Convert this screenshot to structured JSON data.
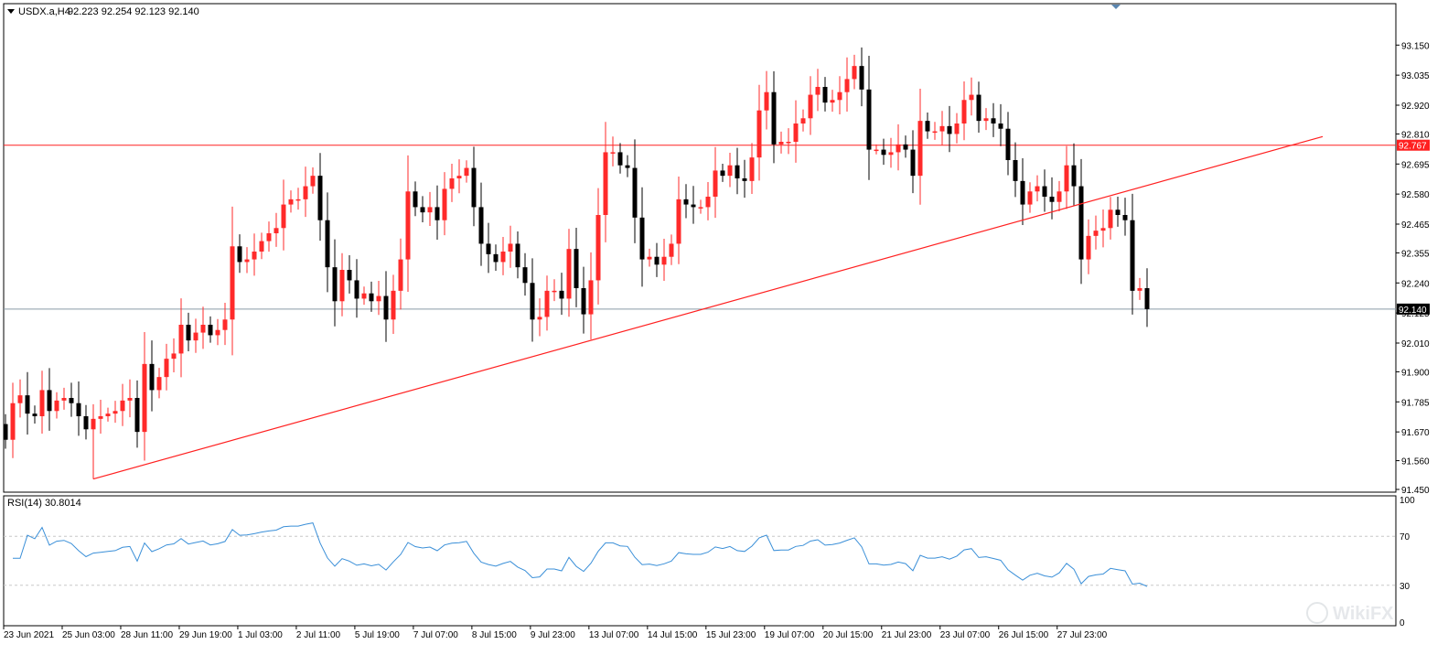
{
  "header": {
    "symbol_timeframe": "USDX.a,H4",
    "ohlc": "92.223 92.254 92.123 92.140"
  },
  "indicator": {
    "label": "RSI(14) 30.8014"
  },
  "watermark": "WikiFX",
  "colors": {
    "bull": "#ff2a2a",
    "bear": "#000000",
    "trendline": "#ff2020",
    "resistance": "#ff2020",
    "current_price": "#8a9aa6",
    "rsi_line": "#3a8fd8",
    "rsi_levels": "#c8c8c8",
    "axis": "#000000"
  },
  "chart_data": [
    {
      "type": "candlestick",
      "title": "USDX.a,H4",
      "ylim": [
        91.45,
        93.2
      ],
      "y_ticks": [
        "93.150",
        "93.035",
        "92.920",
        "92.810",
        "92.695",
        "92.580",
        "92.465",
        "92.355",
        "92.240",
        "92.125",
        "92.010",
        "91.900",
        "91.785",
        "91.670",
        "91.560",
        "91.450"
      ],
      "x_ticks": [
        "23 Jun 2021",
        "25 Jun 03:00",
        "28 Jun 11:00",
        "29 Jun 19:00",
        "1 Jul 03:00",
        "2 Jul 11:00",
        "5 Jul 19:00",
        "7 Jul 07:00",
        "8 Jul 15:00",
        "9 Jul 23:00",
        "13 Jul 07:00",
        "14 Jul 15:00",
        "15 Jul 23:00",
        "19 Jul 07:00",
        "20 Jul 15:00",
        "21 Jul 23:00",
        "23 Jul 07:00",
        "26 Jul 15:00",
        "27 Jul 23:00"
      ],
      "resistance_level": 92.767,
      "resistance_label": "92.767",
      "current_price": 92.14,
      "current_price_label": "92.140",
      "trendline": {
        "from_bar": 12,
        "from_price": 91.49,
        "to_bar": 175,
        "to_price": 92.8
      },
      "closes": [
        91.64,
        91.78,
        91.81,
        91.74,
        91.73,
        91.83,
        91.75,
        91.79,
        91.8,
        91.78,
        91.73,
        91.68,
        91.72,
        91.73,
        91.74,
        91.75,
        91.79,
        91.8,
        91.67,
        91.93,
        91.83,
        91.88,
        91.95,
        91.97,
        92.08,
        92.02,
        92.05,
        92.08,
        92.04,
        92.06,
        92.1,
        92.38,
        92.32,
        92.33,
        92.36,
        92.4,
        92.43,
        92.45,
        92.54,
        92.56,
        92.56,
        92.61,
        92.65,
        92.48,
        92.3,
        92.17,
        92.29,
        92.25,
        92.18,
        92.2,
        92.17,
        92.19,
        92.1,
        92.21,
        92.33,
        92.59,
        92.53,
        92.51,
        92.53,
        92.48,
        92.6,
        92.64,
        92.65,
        92.68,
        92.53,
        92.39,
        92.35,
        92.32,
        92.36,
        92.39,
        92.3,
        92.24,
        92.1,
        92.11,
        92.21,
        92.21,
        92.18,
        92.37,
        92.22,
        92.12,
        92.25,
        92.5,
        92.74,
        92.74,
        92.69,
        92.68,
        92.49,
        92.33,
        92.34,
        92.31,
        92.34,
        92.39,
        92.56,
        92.54,
        92.53,
        92.53,
        92.57,
        92.67,
        92.65,
        92.69,
        92.64,
        92.63,
        92.72,
        92.9,
        92.97,
        92.77,
        92.78,
        92.78,
        92.85,
        92.87,
        92.96,
        92.99,
        92.93,
        92.94,
        92.97,
        93.02,
        93.07,
        92.98,
        92.75,
        92.75,
        92.73,
        92.74,
        92.77,
        92.75,
        92.65,
        92.86,
        92.82,
        92.82,
        92.84,
        92.81,
        92.85,
        92.94,
        92.96,
        92.86,
        92.87,
        92.85,
        92.83,
        92.71,
        92.63,
        92.54,
        92.59,
        92.61,
        92.57,
        92.55,
        92.59,
        92.69,
        92.61,
        92.33,
        92.42,
        92.44,
        92.45,
        92.52,
        92.5,
        92.48,
        92.21,
        92.22,
        92.14
      ],
      "rsi": {
        "title": "RSI(14) 30.8014",
        "ylim": [
          0,
          100
        ],
        "levels": [
          30,
          70
        ],
        "y_ticks": [
          "100",
          "70",
          "30",
          "0"
        ],
        "last": 30.8014
      }
    }
  ]
}
